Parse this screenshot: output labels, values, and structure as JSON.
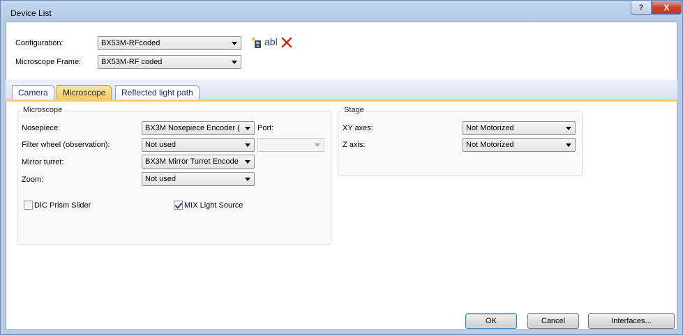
{
  "window": {
    "title": "Device List",
    "help_glyph": "?",
    "close_glyph": "X"
  },
  "config": {
    "configuration_label": "Configuration:",
    "configuration_value": "BX53M-RFcoded",
    "frame_label": "Microscope Frame:",
    "frame_value": "BX53M-RF coded",
    "rename_text": "abl",
    "icons": [
      "new-configuration-icon",
      "rename-icon",
      "delete-icon"
    ]
  },
  "tabs": [
    {
      "label": "Camera",
      "active": false
    },
    {
      "label": "Microscope",
      "active": true
    },
    {
      "label": "Reflected light path",
      "active": false
    }
  ],
  "microscope_group": {
    "title": "Microscope",
    "nosepiece_label": "Nosepiece:",
    "nosepiece_value": "BX3M Nosepiece Encoder (",
    "port_label": "Port:",
    "port_value": "",
    "filter_label": "Filter wheel (observation):",
    "filter_value": "Not used",
    "mirror_label": "Mirror turret:",
    "mirror_value": "BX3M Mirror Turret Encode",
    "zoom_label": "Zoom:",
    "zoom_value": "Not used",
    "dic_label": "DIC Prism Slider",
    "dic_checked": false,
    "mix_label": "MIX Light Source",
    "mix_checked": true
  },
  "stage_group": {
    "title": "Stage",
    "xy_label": "XY axes:",
    "xy_value": "Not Motorized",
    "z_label": "Z axis:",
    "z_value": "Not Motorized"
  },
  "buttons": {
    "ok": "OK",
    "cancel": "Cancel",
    "interfaces": "Interfaces..."
  },
  "colors": {
    "active_tab": "#f5ca5e",
    "delete_icon": "#d9261c",
    "window_frame": "#b5cae6"
  }
}
